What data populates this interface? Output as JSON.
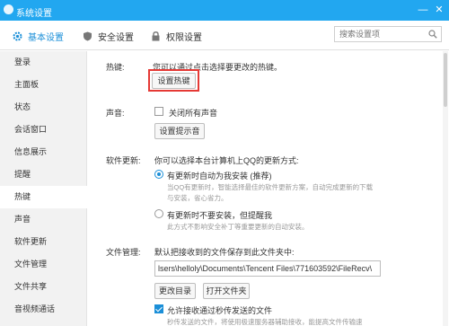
{
  "window": {
    "title": "系统设置",
    "minimize": "—",
    "close": "✕"
  },
  "tabs": [
    {
      "label": "基本设置",
      "icon": "gear-icon",
      "active": true
    },
    {
      "label": "安全设置",
      "icon": "shield-icon",
      "active": false
    },
    {
      "label": "权限设置",
      "icon": "lock-icon",
      "active": false
    }
  ],
  "search": {
    "placeholder": "搜索设置项",
    "icon": "search-icon"
  },
  "sidebar": {
    "items": [
      {
        "label": "登录"
      },
      {
        "label": "主面板"
      },
      {
        "label": "状态"
      },
      {
        "label": "会话窗口"
      },
      {
        "label": "信息展示"
      },
      {
        "label": "提醒"
      },
      {
        "label": "热键",
        "active": true
      },
      {
        "label": "声音"
      },
      {
        "label": "软件更新"
      },
      {
        "label": "文件管理"
      },
      {
        "label": "文件共享"
      },
      {
        "label": "音视频通话"
      }
    ]
  },
  "hotkey": {
    "label": "热键:",
    "description": "您可以通过点击选择要更改的热键。",
    "button": "设置热键",
    "highlight_color": "#e53935"
  },
  "sound": {
    "label": "声音:",
    "mute_all": "关闭所有声音",
    "mute_all_checked": false,
    "button": "设置提示音"
  },
  "update": {
    "label": "软件更新:",
    "description": "你可以选择本台计算机上QQ的更新方式:",
    "option1": "有更新时自动为我安装 (推荐)",
    "option1_selected": true,
    "option1_desc1": "当QQ有更新时，智能选择最佳的软件更新方案，自动完成更新的下载",
    "option1_desc2": "与安装，省心省力。",
    "option2": "有更新时不要安装，但提醒我",
    "option2_selected": false,
    "option2_desc": "此方式不影响安全补丁等重要更新的自动安装。"
  },
  "files": {
    "label": "文件管理:",
    "description": "默认把接收到的文件保存到此文件夹中:",
    "path": "lsers\\helloly\\Documents\\Tencent Files\\771603592\\FileRecv\\",
    "change_dir": "更改目录",
    "open_folder": "打开文件夹",
    "allow_relay": "允许接收通过秒传发送的文件",
    "allow_relay_checked": true,
    "relay_desc": "秒传发送的文件，将使用极速服务器辅助接收，能提高文件传输速"
  },
  "colors": {
    "accent": "#1b8fd8",
    "titlebar": "#22a7f0"
  }
}
